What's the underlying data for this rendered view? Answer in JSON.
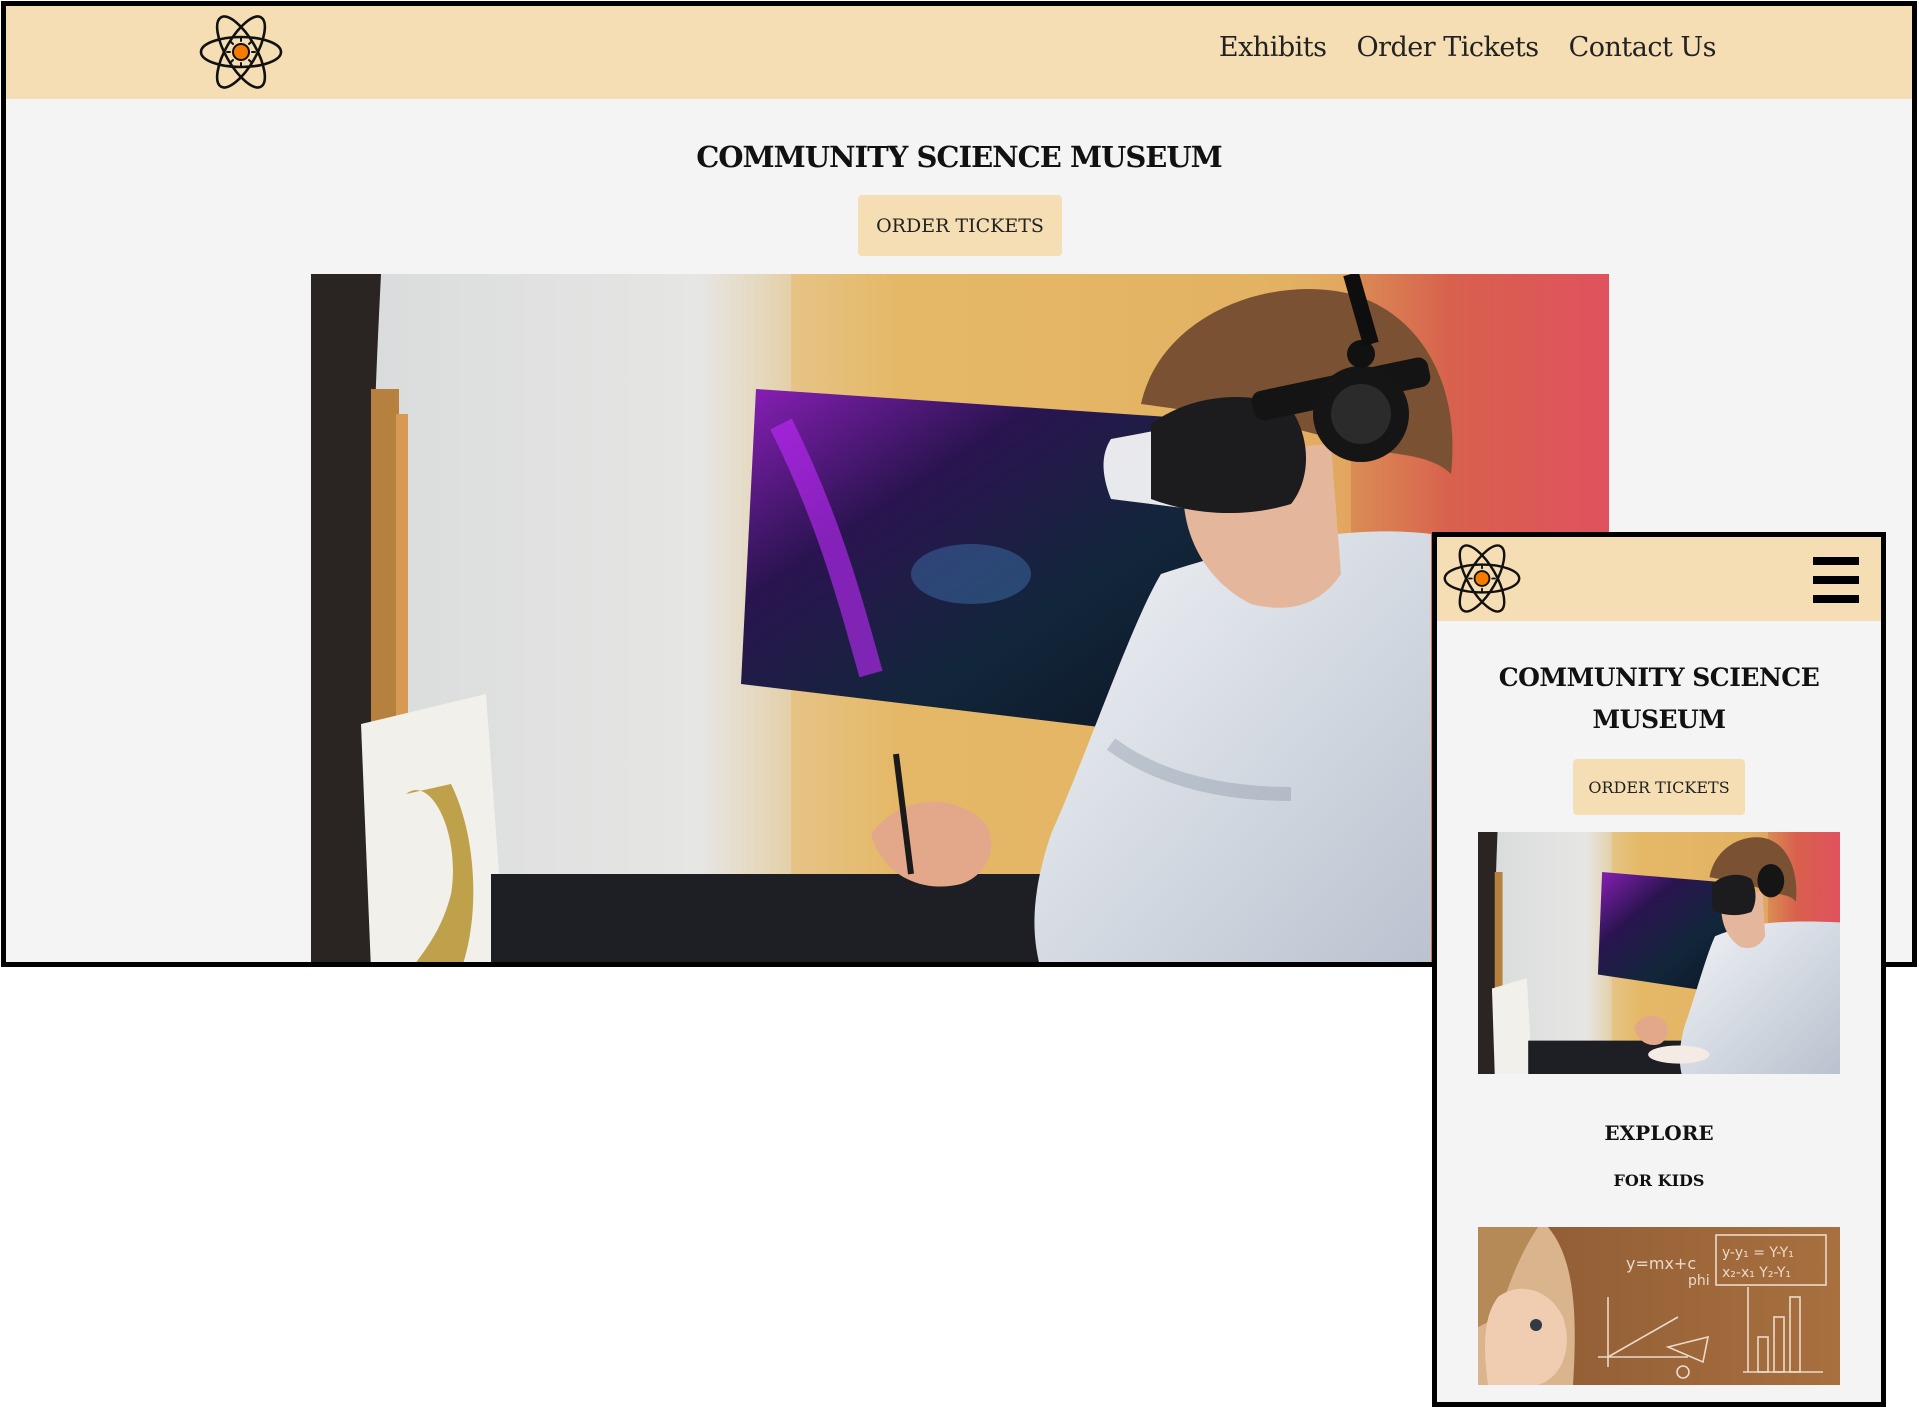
{
  "desktop": {
    "logo_icon": "atom-icon",
    "nav": [
      "Exhibits",
      "Order Tickets",
      "Contact Us"
    ],
    "title": "COMMUNITY SCIENCE MUSEUM",
    "cta_label": "ORDER TICKETS",
    "hero_image": "vr-headset-painting-photo"
  },
  "mobile": {
    "logo_icon": "atom-icon",
    "menu_icon": "hamburger-menu-icon",
    "title": "COMMUNITY SCIENCE MUSEUM",
    "cta_label": "ORDER TICKETS",
    "hero_image": "vr-headset-painting-photo",
    "section_heading": "EXPLORE",
    "section_subheading": "FOR KIDS",
    "kids_image": "girl-chalkboard-math-photo"
  },
  "colors": {
    "header_bg": "#f5deb3",
    "page_bg": "#f4f4f4",
    "button_bg": "#f5deb3",
    "frame_border": "#000000",
    "logo_accent": "#f57c00"
  }
}
